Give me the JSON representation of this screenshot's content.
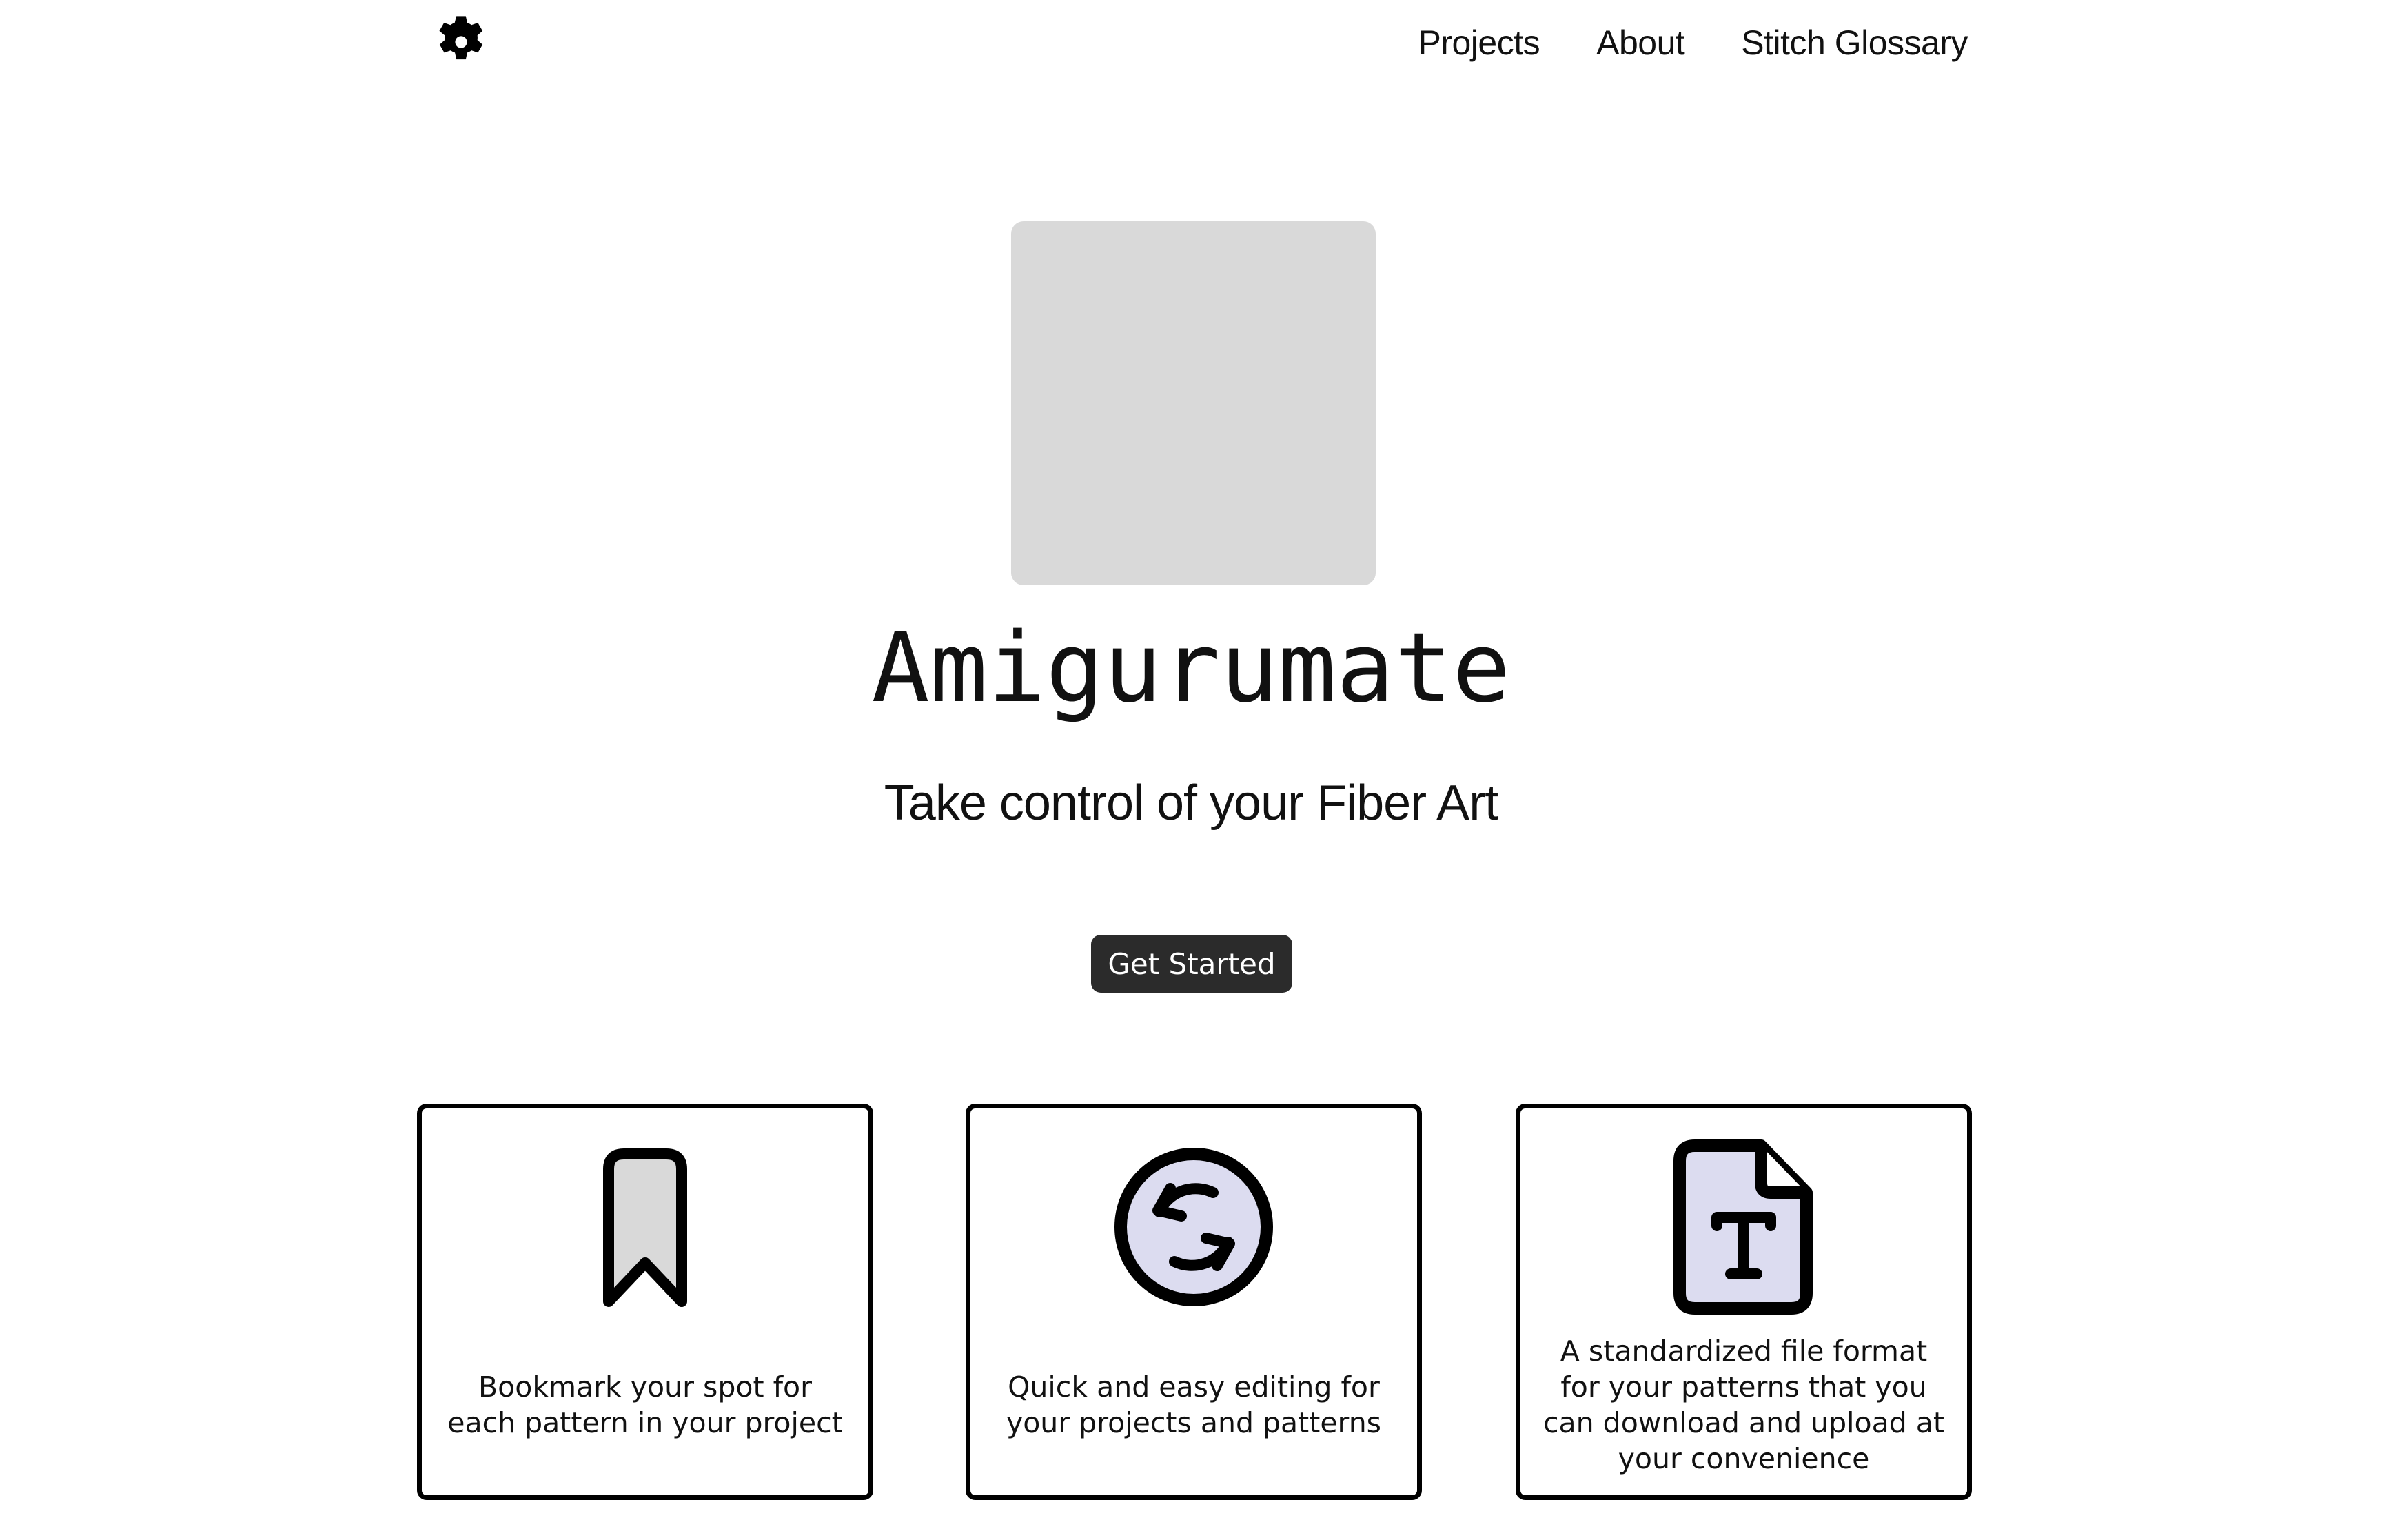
{
  "header": {
    "logo_icon": "gear-icon",
    "nav": {
      "projects": "Projects",
      "about": "About",
      "glossary": "Stitch Glossary"
    }
  },
  "hero": {
    "title": "Amigurumate",
    "subtitle": "Take control of your Fiber Art",
    "cta_label": "Get Started",
    "image_placeholder_color": "#d9d9d9"
  },
  "features": [
    {
      "icon": "bookmark-icon",
      "text": "Bookmark your spot for each pattern in your project"
    },
    {
      "icon": "sync-icon",
      "text": "Quick and easy editing for your projects and patterns"
    },
    {
      "icon": "text-file-icon",
      "text": "A standardized file format for your patterns that you can download and upload at your convenience"
    }
  ],
  "colors": {
    "button_bg": "#2b2b2b",
    "icon_fill_gray": "#d9d9d9",
    "icon_fill_lavender": "#dcdcf0",
    "border": "#000000"
  }
}
